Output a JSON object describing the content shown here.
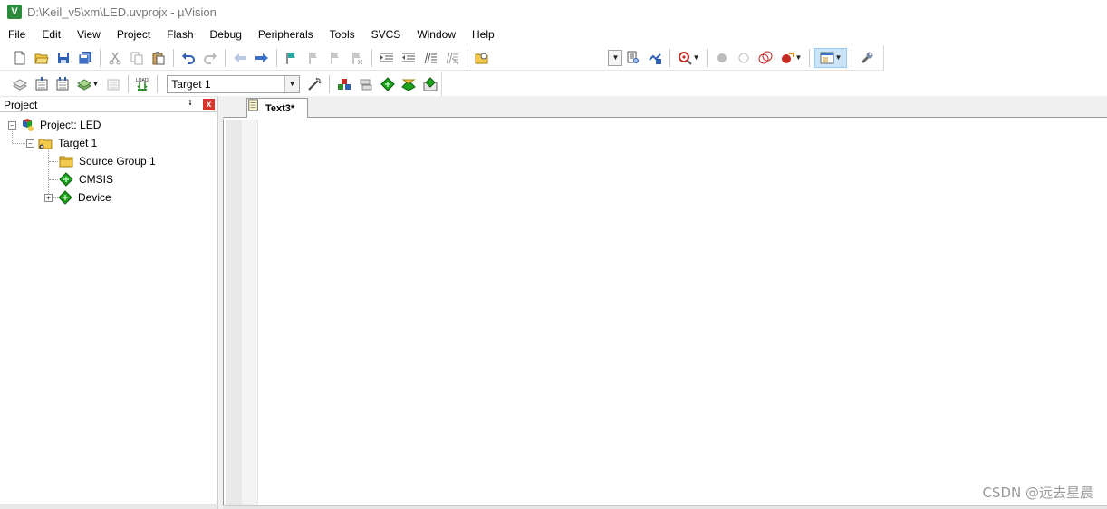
{
  "window": {
    "title": "D:\\Keil_v5\\xm\\LED.uvprojx - µVision",
    "app_icon": "keil-uvision-icon"
  },
  "menu": {
    "items": [
      "File",
      "Edit",
      "View",
      "Project",
      "Flash",
      "Debug",
      "Peripherals",
      "Tools",
      "SVCS",
      "Window",
      "Help"
    ]
  },
  "toolbar2": {
    "target_select": "Target 1"
  },
  "project_panel": {
    "title": "Project",
    "pin_glyph": "⭭",
    "close_glyph": "x",
    "tree": {
      "root": "Project: LED",
      "target": "Target 1",
      "children": [
        "Source Group 1",
        "CMSIS",
        "Device"
      ]
    }
  },
  "editor": {
    "tab_label": "Text3*"
  },
  "watermark": "CSDN @远去星晨",
  "colors": {
    "accent_blue": "#3a6fc8",
    "close_red": "#d9352c",
    "green_diamond": "#1ea11e",
    "folder_yellow": "#f2c94c"
  }
}
